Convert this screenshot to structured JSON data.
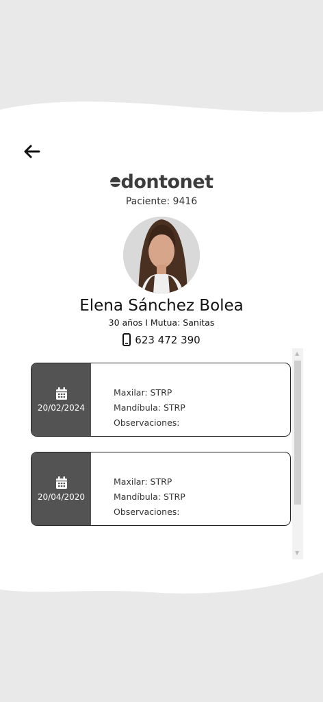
{
  "brand": {
    "logo_text": "dontonet"
  },
  "patient": {
    "id_label": "Paciente: 9416",
    "name": "Elena Sánchez Bolea",
    "details": "30 años I Mutua: Sanitas",
    "phone": "623 472 390"
  },
  "visits": [
    {
      "date": "20/02/2024",
      "maxilar": "Maxilar: STRP",
      "mandibula": "Mandíbula: STRP",
      "observaciones": "Observaciones:"
    },
    {
      "date": "20/04/2020",
      "maxilar": "Maxilar: STRP",
      "mandibula": "Mandíbula: STRP",
      "observaciones": "Observaciones:"
    }
  ],
  "icons": {
    "back": "arrow-left-icon",
    "phone": "mobile-phone-icon",
    "calendar": "calendar-icon"
  },
  "colors": {
    "background": "#e9e9e9",
    "panel": "#ffffff",
    "date_column": "#535353",
    "logo": "#3c3c3c"
  }
}
